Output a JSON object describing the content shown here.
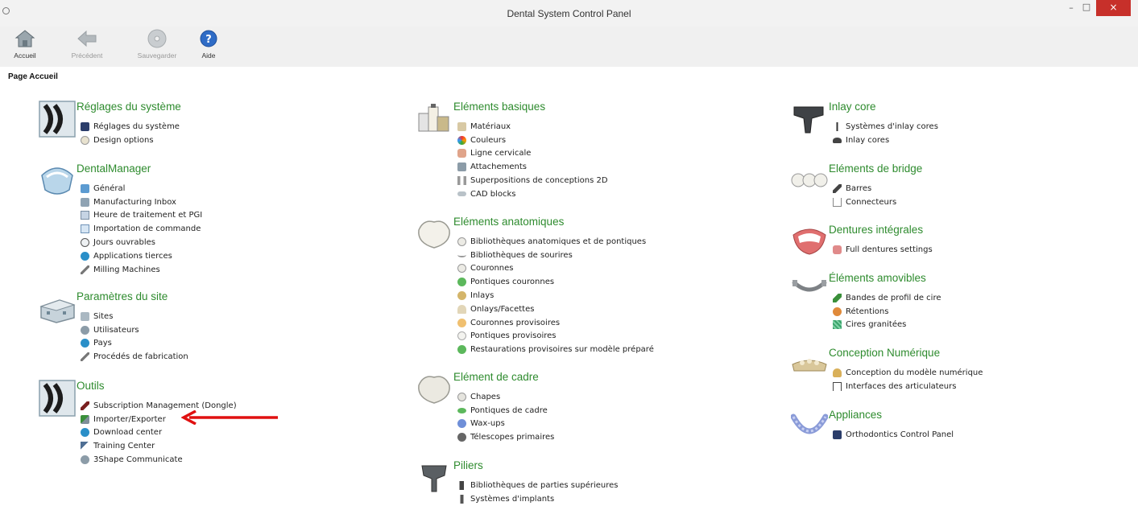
{
  "window": {
    "title": "Dental System Control Panel",
    "minimize": "–",
    "maximize": "□",
    "close": "×"
  },
  "toolbar": {
    "home_label": "Accueil",
    "back_label": "Précédent",
    "save_label": "Sauvegarder",
    "help_label": "Aide"
  },
  "page": {
    "label": "Page Accueil"
  },
  "sections": {
    "systeme": {
      "title": "Réglages du système",
      "items": [
        "Réglages du système",
        "Design options"
      ]
    },
    "dentalmanager": {
      "title": "DentalManager",
      "items": [
        "Général",
        "Manufacturing Inbox",
        "Heure de traitement et PGI",
        "Importation de commande",
        "Jours ouvrables",
        "Applications tierces",
        "Milling Machines"
      ]
    },
    "site": {
      "title": "Paramètres du site",
      "items": [
        "Sites",
        "Utilisateurs",
        "Pays",
        "Procédés de fabrication"
      ]
    },
    "outils": {
      "title": "Outils",
      "items": [
        "Subscription Management (Dongle)",
        "Importer/Exporter",
        "Download center",
        "Training Center",
        "3Shape Communicate"
      ]
    },
    "basiques": {
      "title": "Eléments basiques",
      "items": [
        "Matériaux",
        "Couleurs",
        "Ligne cervicale",
        "Attachements",
        "Superpositions de conceptions 2D",
        "CAD blocks"
      ]
    },
    "anatomiques": {
      "title": "Eléments anatomiques",
      "items": [
        "Bibliothèques anatomiques et de pontiques",
        "Bibliothèques de sourires",
        "Couronnes",
        "Pontiques couronnes",
        "Inlays",
        "Onlays/Facettes",
        "Couronnes provisoires",
        "Pontiques provisoires",
        "Restaurations provisoires sur modèle préparé"
      ]
    },
    "cadre": {
      "title": "Elément de cadre",
      "items": [
        "Chapes",
        "Pontiques de cadre",
        "Wax-ups",
        "Télescopes primaires"
      ]
    },
    "piliers": {
      "title": "Piliers",
      "items": [
        "Bibliothèques de parties supérieures",
        "Systèmes d'implants"
      ]
    },
    "inlaycore": {
      "title": "Inlay core",
      "items": [
        "Systèmes d'inlay cores",
        "Inlay cores"
      ]
    },
    "bridge": {
      "title": "Eléments de bridge",
      "items": [
        "Barres",
        "Connecteurs"
      ]
    },
    "dentures": {
      "title": "Dentures intégrales",
      "items": [
        "Full dentures settings"
      ]
    },
    "amovibles": {
      "title": "Éléments amovibles",
      "items": [
        "Bandes de profil de cire",
        "Rétentions",
        "Cires granitées"
      ]
    },
    "numerique": {
      "title": "Conception Numérique",
      "items": [
        "Conception du modèle numérique",
        "Interfaces des articulateurs"
      ]
    },
    "appliances": {
      "title": "Appliances",
      "items": [
        "Orthodontics Control Panel"
      ]
    }
  },
  "colors": {
    "section_title": "#2e8b2e",
    "annotation_arrow": "#e01010",
    "close_button": "#c7302a"
  }
}
